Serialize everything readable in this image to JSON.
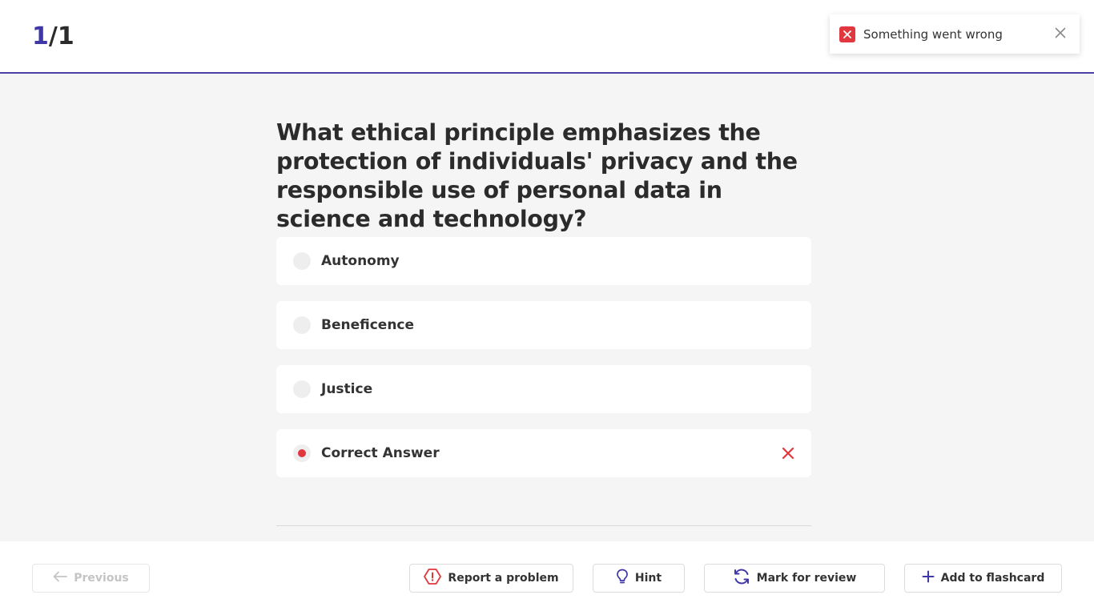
{
  "header": {
    "current": "1",
    "total": "/1"
  },
  "toast": {
    "message": "Something went wrong",
    "icon": "error-icon",
    "close_icon": "close-icon",
    "color": "#e0383e"
  },
  "question": {
    "text": "What ethical principle emphasizes the protection of individuals' privacy and the responsible use of personal data in science and technology?"
  },
  "options": [
    {
      "label": "Autonomy",
      "selected": false
    },
    {
      "label": "Beneficence",
      "selected": false
    },
    {
      "label": "Justice",
      "selected": false
    },
    {
      "label": "Correct Answer",
      "selected": true,
      "status": "incorrect"
    }
  ],
  "footer": {
    "previous": "Previous",
    "report": "Report a problem",
    "hint": "Hint",
    "mark_review": "Mark for review",
    "add_flashcard": "Add to flashcard"
  },
  "colors": {
    "accent": "#3f37a8",
    "error": "#e0383e"
  }
}
